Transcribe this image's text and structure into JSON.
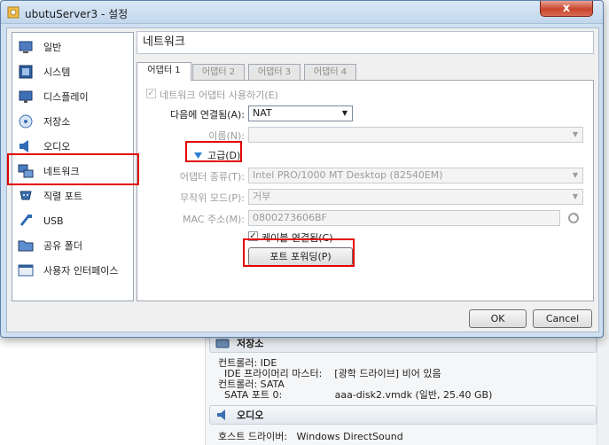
{
  "window": {
    "title": "ubutuServer3 - 설정",
    "close_label": "x"
  },
  "sidebar": {
    "items": [
      {
        "label": "일반"
      },
      {
        "label": "시스템"
      },
      {
        "label": "디스플레이"
      },
      {
        "label": "저장소"
      },
      {
        "label": "오디오"
      },
      {
        "label": "네트워크"
      },
      {
        "label": "직렬 포트"
      },
      {
        "label": "USB"
      },
      {
        "label": "공유 폴더"
      },
      {
        "label": "사용자 인터페이스"
      }
    ],
    "selected_index": 5
  },
  "page": {
    "title": "네트워크"
  },
  "tabs": [
    {
      "label": "어댑터 1",
      "active": true
    },
    {
      "label": "어댑터 2",
      "active": false
    },
    {
      "label": "어댑터 3",
      "active": false
    },
    {
      "label": "어댑터 4",
      "active": false
    }
  ],
  "adapter": {
    "enable_label": "네트워크 어댑터 사용하기(E)",
    "enable_checked": true,
    "attached_label": "다음에 연결됨(A):",
    "attached_value": "NAT",
    "name_label": "이름(N):",
    "name_value": "",
    "advanced_label": "고급(D)",
    "type_label": "어댑터 종류(T):",
    "type_value": "Intel PRO/1000 MT Desktop (82540EM)",
    "promisc_label": "무작위 모드(P):",
    "promisc_value": "거부",
    "mac_label": "MAC 주소(M):",
    "mac_value": "0800273606BF",
    "cable_label": "케이블 연결됨(C)",
    "cable_checked": true,
    "port_forward_label": "포트 포워딩(P)"
  },
  "buttons": {
    "ok": "OK",
    "cancel": "Cancel"
  },
  "background": {
    "storage_head": "저장소",
    "storage_lines": [
      "컨트롤러: IDE",
      "  IDE 프라이머리 마스터:    [광학 드라이브] 비어 있음",
      "컨트롤러: SATA",
      "  SATA 포트 0:                 aaa-disk2.vmdk (일반, 25.40 GB)"
    ],
    "audio_head": "오디오",
    "audio_lines": [
      "호스트 드라이버:   Windows DirectSound"
    ]
  },
  "colors": {
    "highlight_red": "#e20000",
    "title_bar": "#c2d6ec",
    "close_red": "#c9452c"
  }
}
